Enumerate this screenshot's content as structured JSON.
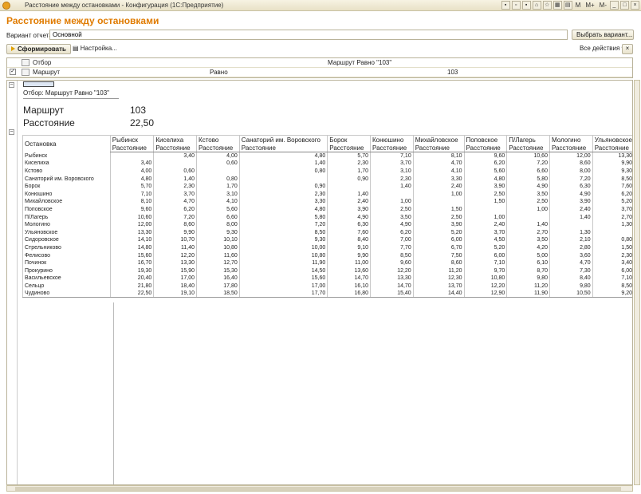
{
  "window": {
    "title": "Расстояние между остановками - Конфигурация  (1С:Предприятие)",
    "m_labels": [
      "M",
      "M+",
      "M-"
    ]
  },
  "header": {
    "title": "Расстояние между остановками"
  },
  "variant": {
    "label": "Вариант отчета:",
    "value": "Основной",
    "select_button": "Выбрать вариант..."
  },
  "toolbar": {
    "generate": "Сформировать",
    "settings": "Настройка...",
    "all_actions": "Все действия",
    "close": "×"
  },
  "filters": {
    "head": {
      "field": "Отбор",
      "value": "Маршрут Равно \"103\""
    },
    "row": {
      "checked": "✓",
      "field": "Маршрут",
      "condition": "Равно",
      "value": "103"
    }
  },
  "report": {
    "filter_text": "Отбор:     Маршрут Равно \"103\"",
    "route_label": "Маршрут",
    "route_value": "103",
    "distance_label": "Расстояние",
    "distance_value": "22,50",
    "row_header": "Остановка",
    "subheader": "Расстояние",
    "columns": [
      "Рыбинск",
      "Киселиха",
      "Кстово",
      "Санаторий им. Воровского",
      "Борок",
      "Конюшино",
      "Михайловское",
      "Поповское",
      "П/Лагерь",
      "Мологино",
      "Ульяновское"
    ],
    "rows": [
      {
        "name": "Рыбинск",
        "v": [
          "",
          "3,40",
          "4,00",
          "4,80",
          "5,70",
          "7,10",
          "8,10",
          "9,60",
          "10,60",
          "12,00",
          "13,30"
        ]
      },
      {
        "name": "Киселиха",
        "v": [
          "3,40",
          "",
          "0,60",
          "1,40",
          "2,30",
          "3,70",
          "4,70",
          "6,20",
          "7,20",
          "8,60",
          "9,90"
        ]
      },
      {
        "name": "Кстово",
        "v": [
          "4,00",
          "0,60",
          "",
          "0,80",
          "1,70",
          "3,10",
          "4,10",
          "5,60",
          "6,60",
          "8,00",
          "9,30"
        ]
      },
      {
        "name": "Санаторий им. Воровского",
        "v": [
          "4,80",
          "1,40",
          "0,80",
          "",
          "0,90",
          "2,30",
          "3,30",
          "4,80",
          "5,80",
          "7,20",
          "8,50"
        ]
      },
      {
        "name": "Борок",
        "v": [
          "5,70",
          "2,30",
          "1,70",
          "0,90",
          "",
          "1,40",
          "2,40",
          "3,90",
          "4,90",
          "6,30",
          "7,60"
        ]
      },
      {
        "name": "Конюшино",
        "v": [
          "7,10",
          "3,70",
          "3,10",
          "2,30",
          "1,40",
          "",
          "1,00",
          "2,50",
          "3,50",
          "4,90",
          "6,20"
        ]
      },
      {
        "name": "Михайловское",
        "v": [
          "8,10",
          "4,70",
          "4,10",
          "3,30",
          "2,40",
          "1,00",
          "",
          "1,50",
          "2,50",
          "3,90",
          "5,20"
        ]
      },
      {
        "name": "Поповское",
        "v": [
          "9,60",
          "6,20",
          "5,60",
          "4,80",
          "3,90",
          "2,50",
          "1,50",
          "",
          "1,00",
          "2,40",
          "3,70"
        ]
      },
      {
        "name": "П/Лагерь",
        "v": [
          "10,60",
          "7,20",
          "6,60",
          "5,80",
          "4,90",
          "3,50",
          "2,50",
          "1,00",
          "",
          "1,40",
          "2,70"
        ]
      },
      {
        "name": "Мологино",
        "v": [
          "12,00",
          "8,60",
          "8,00",
          "7,20",
          "6,30",
          "4,90",
          "3,90",
          "2,40",
          "1,40",
          "",
          "1,30"
        ]
      },
      {
        "name": "Ульяновское",
        "v": [
          "13,30",
          "9,90",
          "9,30",
          "8,50",
          "7,60",
          "6,20",
          "5,20",
          "3,70",
          "2,70",
          "1,30",
          ""
        ]
      },
      {
        "name": "Сидоровское",
        "v": [
          "14,10",
          "10,70",
          "10,10",
          "9,30",
          "8,40",
          "7,00",
          "6,00",
          "4,50",
          "3,50",
          "2,10",
          "0,80"
        ]
      },
      {
        "name": "Стрельниково",
        "v": [
          "14,80",
          "11,40",
          "10,80",
          "10,00",
          "9,10",
          "7,70",
          "6,70",
          "5,20",
          "4,20",
          "2,80",
          "1,50"
        ]
      },
      {
        "name": "Фелисово",
        "v": [
          "15,60",
          "12,20",
          "11,60",
          "10,80",
          "9,90",
          "8,50",
          "7,50",
          "6,00",
          "5,00",
          "3,60",
          "2,30"
        ]
      },
      {
        "name": "Починок",
        "v": [
          "16,70",
          "13,30",
          "12,70",
          "11,90",
          "11,00",
          "9,60",
          "8,60",
          "7,10",
          "6,10",
          "4,70",
          "3,40"
        ]
      },
      {
        "name": "Прокурино",
        "v": [
          "19,30",
          "15,90",
          "15,30",
          "14,50",
          "13,60",
          "12,20",
          "11,20",
          "9,70",
          "8,70",
          "7,30",
          "6,00"
        ]
      },
      {
        "name": "Васильевское",
        "v": [
          "20,40",
          "17,00",
          "16,40",
          "15,60",
          "14,70",
          "13,30",
          "12,30",
          "10,80",
          "9,80",
          "8,40",
          "7,10"
        ]
      },
      {
        "name": "Сельцо",
        "v": [
          "21,80",
          "18,40",
          "17,80",
          "17,00",
          "16,10",
          "14,70",
          "13,70",
          "12,20",
          "11,20",
          "9,80",
          "8,50"
        ]
      },
      {
        "name": "Чудиново",
        "v": [
          "22,50",
          "19,10",
          "18,50",
          "17,70",
          "16,80",
          "15,40",
          "14,40",
          "12,90",
          "11,90",
          "10,50",
          "9,20"
        ]
      }
    ]
  }
}
